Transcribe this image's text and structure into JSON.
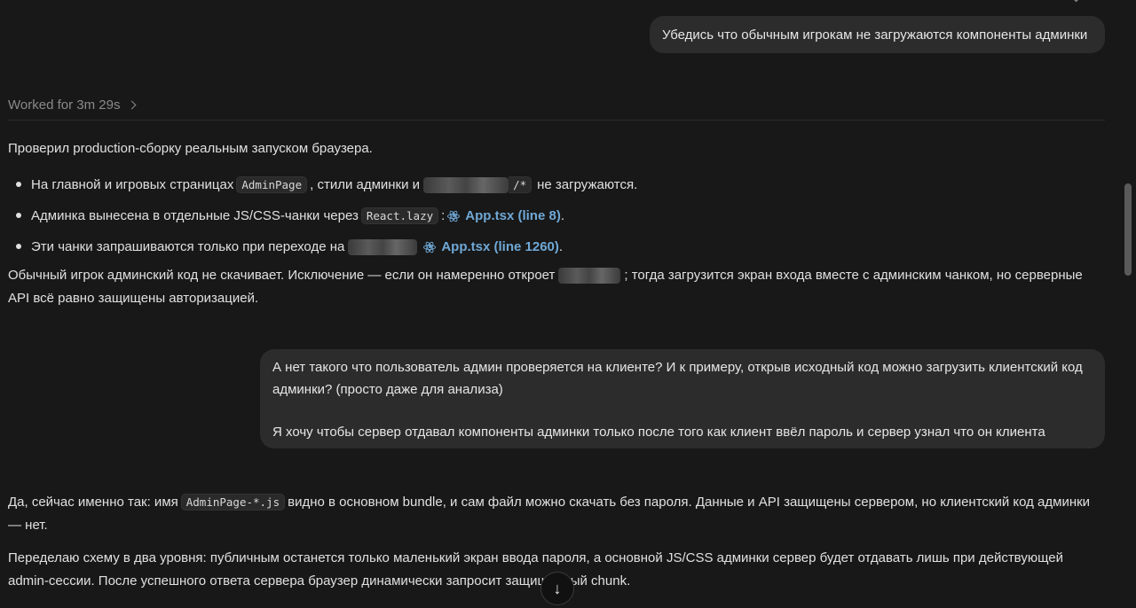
{
  "top": {
    "clipped_text": "· · · ·  · · · · · ·",
    "icons": [
      "chevron-icon",
      "more-icon"
    ]
  },
  "messages": {
    "user1": "Убедись что обычным игрокам не загружаются компоненты админки",
    "worked": "Worked for 3m 29s",
    "assistant1": {
      "intro": "Проверил production-сборку реальным запуском браузера.",
      "items": [
        {
          "pre": "На главной и игровых страницах",
          "code": "AdminPage",
          "mid": ", стили админки и",
          "code2": "/*",
          "post": "не загружаются."
        },
        {
          "pre": "Админка вынесена в отдельные JS/CSS-чанки через",
          "code": "React.lazy",
          "mid": ":",
          "link": "App.tsx (line 8)",
          "post": "."
        },
        {
          "pre": "Эти чанки запрашиваются только при переходе на",
          "link": "App.tsx (line 1260)",
          "post": "."
        }
      ],
      "summary_a": "Обычный игрок админский код не скачивает. Исключение — если он намеренно откроет",
      "summary_b": "; тогда загрузится экран входа вместе с админским чанком, но серверные API всё равно защищены авторизацией."
    },
    "user2": {
      "line1": "А нет такого что пользователь админ проверяется на клиенте? И к примеру, открыв исходный код можно загрузить клиентский код админки? (просто даже для анализа)",
      "line2": "Я хочу чтобы сервер отдавал компоненты админки только после того как клиент ввёл пароль и сервер узнал что он клиента"
    },
    "assistant2": {
      "p1_a": "Да, сейчас именно так: имя",
      "p1_code": "AdminPage-*.js",
      "p1_b": "видно в основном bundle, и сам файл можно скачать без пароля. Данные и API защищены сервером, но клиентский код админки — нет.",
      "p2": "Переделаю схему в два уровня: публичным останется только маленький экран ввода пароля, а основной JS/CSS админки сервер будет отдавать лишь при действующей admin-сессии. После успешного ответа сервера браузер динамически запросит защищённый chunk."
    }
  },
  "colors": {
    "background": "#181818",
    "bubble": "#2c2c2c",
    "link": "#6fa8d6",
    "muted": "#8a8a8a"
  }
}
